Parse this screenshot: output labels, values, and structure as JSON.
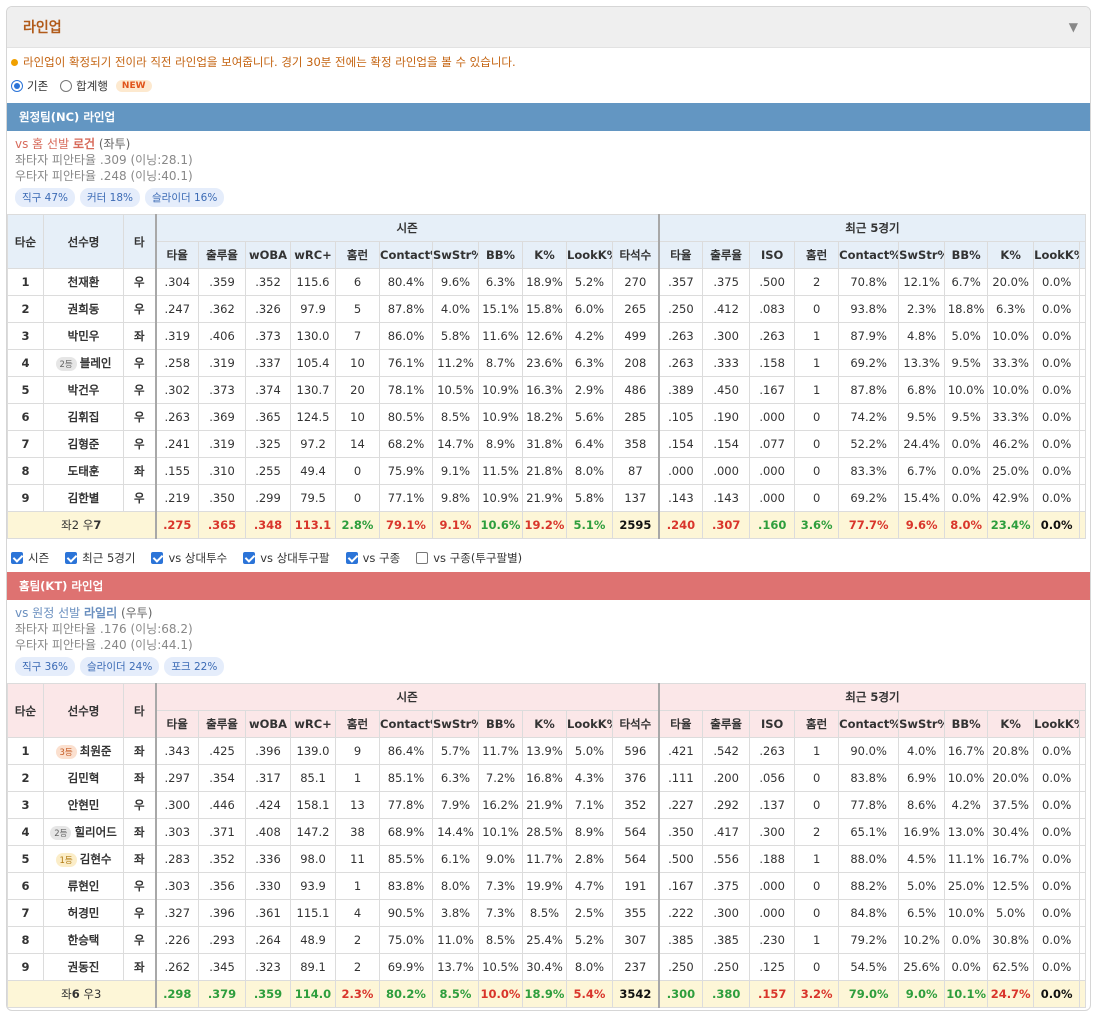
{
  "panel": {
    "title": "라인업",
    "notice": "라인업이 확정되기 전이라 직전 라인업을 보여줍니다. 경기 30분 전에는 확정 라인업을 볼 수 있습니다.",
    "radio_basic": "기존",
    "radio_sum": "합계행",
    "new_badge": "NEW",
    "selected": "기존"
  },
  "headers": {
    "order": "타순",
    "player": "선수명",
    "bat": "타",
    "season": "시즌",
    "recent": "최근 5경기",
    "season_cols": [
      "타율",
      "출루율",
      "wOBA",
      "wRC+",
      "홈런",
      "Contact%",
      "SwStr%",
      "BB%",
      "K%",
      "LookK%",
      "타석수"
    ],
    "recent_cols": [
      "타율",
      "출루율",
      "ISO",
      "홈런",
      "Contact%",
      "SwStr%",
      "BB%",
      "K%",
      "LookK%"
    ]
  },
  "away": {
    "bar": "원정팀(NC) 라인업",
    "vs_prefix": "vs 홈 선발",
    "pitcher": "로건",
    "hand": "(좌투)",
    "lhb": "좌타자 피안타율 .309 (이닝:28.1)",
    "rhb": "우타자 피안타율 .248 (이닝:40.1)",
    "pitches": [
      "직구 47%",
      "커터 18%",
      "슬라이더 16%"
    ],
    "rows": [
      {
        "n": "1",
        "name": "천재환",
        "badge": "",
        "b": "우",
        "s": [
          ".304",
          ".359",
          ".352",
          "115.6",
          "6",
          "80.4%",
          "9.6%",
          "6.3%",
          "18.9%",
          "5.2%",
          "270"
        ],
        "r": [
          ".357",
          ".375",
          ".500",
          "2",
          "70.8%",
          "12.1%",
          "6.7%",
          "20.0%",
          "0.0%"
        ]
      },
      {
        "n": "2",
        "name": "권희동",
        "badge": "",
        "b": "우",
        "s": [
          ".247",
          ".362",
          ".326",
          "97.9",
          "5",
          "87.8%",
          "4.0%",
          "15.1%",
          "15.8%",
          "6.0%",
          "265"
        ],
        "r": [
          ".250",
          ".412",
          ".083",
          "0",
          "93.8%",
          "2.3%",
          "18.8%",
          "6.3%",
          "0.0%"
        ]
      },
      {
        "n": "3",
        "name": "박민우",
        "badge": "",
        "b": "좌",
        "s": [
          ".319",
          ".406",
          ".373",
          "130.0",
          "7",
          "86.0%",
          "5.8%",
          "11.6%",
          "12.6%",
          "4.2%",
          "499"
        ],
        "r": [
          ".263",
          ".300",
          ".263",
          "1",
          "87.9%",
          "4.8%",
          "5.0%",
          "10.0%",
          "0.0%"
        ]
      },
      {
        "n": "4",
        "name": "블레인",
        "badge": "2등",
        "bc": "b2",
        "b": "우",
        "s": [
          ".258",
          ".319",
          ".337",
          "105.4",
          "10",
          "76.1%",
          "11.2%",
          "8.7%",
          "23.6%",
          "6.3%",
          "208"
        ],
        "r": [
          ".263",
          ".333",
          ".158",
          "1",
          "69.2%",
          "13.3%",
          "9.5%",
          "33.3%",
          "0.0%"
        ]
      },
      {
        "n": "5",
        "name": "박건우",
        "badge": "",
        "b": "우",
        "s": [
          ".302",
          ".373",
          ".374",
          "130.7",
          "20",
          "78.1%",
          "10.5%",
          "10.9%",
          "16.3%",
          "2.9%",
          "486"
        ],
        "r": [
          ".389",
          ".450",
          ".167",
          "1",
          "87.8%",
          "6.8%",
          "10.0%",
          "10.0%",
          "0.0%"
        ]
      },
      {
        "n": "6",
        "name": "김휘집",
        "badge": "",
        "b": "우",
        "s": [
          ".263",
          ".369",
          ".365",
          "124.5",
          "10",
          "80.5%",
          "8.5%",
          "10.9%",
          "18.2%",
          "5.6%",
          "285"
        ],
        "r": [
          ".105",
          ".190",
          ".000",
          "0",
          "74.2%",
          "9.5%",
          "9.5%",
          "33.3%",
          "0.0%"
        ]
      },
      {
        "n": "7",
        "name": "김형준",
        "badge": "",
        "b": "우",
        "s": [
          ".241",
          ".319",
          ".325",
          "97.2",
          "14",
          "68.2%",
          "14.7%",
          "8.9%",
          "31.8%",
          "6.4%",
          "358"
        ],
        "r": [
          ".154",
          ".154",
          ".077",
          "0",
          "52.2%",
          "24.4%",
          "0.0%",
          "46.2%",
          "0.0%"
        ]
      },
      {
        "n": "8",
        "name": "도태훈",
        "badge": "",
        "b": "좌",
        "s": [
          ".155",
          ".310",
          ".255",
          "49.4",
          "0",
          "75.9%",
          "9.1%",
          "11.5%",
          "21.8%",
          "8.0%",
          "87"
        ],
        "r": [
          ".000",
          ".000",
          ".000",
          "0",
          "83.3%",
          "6.7%",
          "0.0%",
          "25.0%",
          "0.0%"
        ]
      },
      {
        "n": "9",
        "name": "김한별",
        "badge": "",
        "b": "우",
        "s": [
          ".219",
          ".350",
          ".299",
          "79.5",
          "0",
          "77.1%",
          "9.8%",
          "10.9%",
          "21.9%",
          "5.8%",
          "137"
        ],
        "r": [
          ".143",
          ".143",
          ".000",
          "0",
          "69.2%",
          "15.4%",
          "0.0%",
          "42.9%",
          "0.0%"
        ]
      }
    ],
    "total": {
      "label_pre": "좌2 우",
      "label_bold": "7",
      "s": [
        ".275",
        ".365",
        ".348",
        "113.1",
        "2.8%",
        "79.1%",
        "9.1%",
        "10.6%",
        "19.2%",
        "5.1%",
        "2595"
      ],
      "sc": [
        "r",
        "r",
        "r",
        "r",
        "g",
        "r",
        "r",
        "g",
        "r",
        "g",
        "k"
      ],
      "r": [
        ".240",
        ".307",
        ".160",
        "3.6%",
        "77.7%",
        "9.6%",
        "8.0%",
        "23.4%",
        "0.0%"
      ],
      "rc": [
        "r",
        "r",
        "g",
        "g",
        "r",
        "r",
        "r",
        "g",
        "k"
      ]
    }
  },
  "checks": [
    {
      "label": "시즌",
      "on": true
    },
    {
      "label": "최근 5경기",
      "on": true
    },
    {
      "label": "vs 상대투수",
      "on": true
    },
    {
      "label": "vs 상대투구팔",
      "on": true
    },
    {
      "label": "vs 구종",
      "on": true
    },
    {
      "label": "vs 구종(투구팔별)",
      "on": false
    }
  ],
  "home": {
    "bar": "홈팀(KT) 라인업",
    "vs_prefix": "vs 원정 선발",
    "pitcher": "라일리",
    "hand": "(우투)",
    "lhb": "좌타자 피안타율 .176 (이닝:68.2)",
    "rhb": "우타자 피안타율 .240 (이닝:44.1)",
    "pitches": [
      "직구 36%",
      "슬라이더 24%",
      "포크 22%"
    ],
    "rows": [
      {
        "n": "1",
        "name": "최원준",
        "badge": "3등",
        "bc": "b3",
        "b": "좌",
        "s": [
          ".343",
          ".425",
          ".396",
          "139.0",
          "9",
          "86.4%",
          "5.7%",
          "11.7%",
          "13.9%",
          "5.0%",
          "596"
        ],
        "r": [
          ".421",
          ".542",
          ".263",
          "1",
          "90.0%",
          "4.0%",
          "16.7%",
          "20.8%",
          "0.0%"
        ]
      },
      {
        "n": "2",
        "name": "김민혁",
        "badge": "",
        "b": "좌",
        "s": [
          ".297",
          ".354",
          ".317",
          "85.1",
          "1",
          "85.1%",
          "6.3%",
          "7.2%",
          "16.8%",
          "4.3%",
          "376"
        ],
        "r": [
          ".111",
          ".200",
          ".056",
          "0",
          "83.8%",
          "6.9%",
          "10.0%",
          "20.0%",
          "0.0%"
        ]
      },
      {
        "n": "3",
        "name": "안현민",
        "badge": "",
        "b": "우",
        "s": [
          ".300",
          ".446",
          ".424",
          "158.1",
          "13",
          "77.8%",
          "7.9%",
          "16.2%",
          "21.9%",
          "7.1%",
          "352"
        ],
        "r": [
          ".227",
          ".292",
          ".137",
          "0",
          "77.8%",
          "8.6%",
          "4.2%",
          "37.5%",
          "0.0%"
        ]
      },
      {
        "n": "4",
        "name": "힐리어드",
        "badge": "2등",
        "bc": "b2",
        "b": "좌",
        "s": [
          ".303",
          ".371",
          ".408",
          "147.2",
          "38",
          "68.9%",
          "14.4%",
          "10.1%",
          "28.5%",
          "8.9%",
          "564"
        ],
        "r": [
          ".350",
          ".417",
          ".300",
          "2",
          "65.1%",
          "16.9%",
          "13.0%",
          "30.4%",
          "0.0%"
        ]
      },
      {
        "n": "5",
        "name": "김현수",
        "badge": "1등",
        "bc": "b1",
        "b": "좌",
        "s": [
          ".283",
          ".352",
          ".336",
          "98.0",
          "11",
          "85.5%",
          "6.1%",
          "9.0%",
          "11.7%",
          "2.8%",
          "564"
        ],
        "r": [
          ".500",
          ".556",
          ".188",
          "1",
          "88.0%",
          "4.5%",
          "11.1%",
          "16.7%",
          "0.0%"
        ]
      },
      {
        "n": "6",
        "name": "류현인",
        "badge": "",
        "b": "우",
        "s": [
          ".303",
          ".356",
          ".330",
          "93.9",
          "1",
          "83.8%",
          "8.0%",
          "7.3%",
          "19.9%",
          "4.7%",
          "191"
        ],
        "r": [
          ".167",
          ".375",
          ".000",
          "0",
          "88.2%",
          "5.0%",
          "25.0%",
          "12.5%",
          "0.0%"
        ]
      },
      {
        "n": "7",
        "name": "허경민",
        "badge": "",
        "b": "우",
        "s": [
          ".327",
          ".396",
          ".361",
          "115.1",
          "4",
          "90.5%",
          "3.8%",
          "7.3%",
          "8.5%",
          "2.5%",
          "355"
        ],
        "r": [
          ".222",
          ".300",
          ".000",
          "0",
          "84.8%",
          "6.5%",
          "10.0%",
          "5.0%",
          "0.0%"
        ]
      },
      {
        "n": "8",
        "name": "한승택",
        "badge": "",
        "b": "우",
        "s": [
          ".226",
          ".293",
          ".264",
          "48.9",
          "2",
          "75.0%",
          "11.0%",
          "8.5%",
          "25.4%",
          "5.2%",
          "307"
        ],
        "r": [
          ".385",
          ".385",
          ".230",
          "1",
          "79.2%",
          "10.2%",
          "0.0%",
          "30.8%",
          "0.0%"
        ]
      },
      {
        "n": "9",
        "name": "권동진",
        "badge": "",
        "b": "좌",
        "s": [
          ".262",
          ".345",
          ".323",
          "89.1",
          "2",
          "69.9%",
          "13.7%",
          "10.5%",
          "30.4%",
          "8.0%",
          "237"
        ],
        "r": [
          ".250",
          ".250",
          ".125",
          "0",
          "54.5%",
          "25.6%",
          "0.0%",
          "62.5%",
          "0.0%"
        ]
      }
    ],
    "total": {
      "label_pre": "좌",
      "label_bold": "6",
      "label_post": " 우3",
      "s": [
        ".298",
        ".379",
        ".359",
        "114.0",
        "2.3%",
        "80.2%",
        "8.5%",
        "10.0%",
        "18.9%",
        "5.4%",
        "3542"
      ],
      "sc": [
        "g",
        "g",
        "g",
        "g",
        "r",
        "g",
        "g",
        "r",
        "g",
        "r",
        "k"
      ],
      "r": [
        ".300",
        ".380",
        ".157",
        "3.2%",
        "79.0%",
        "9.0%",
        "10.1%",
        "24.7%",
        "0.0%"
      ],
      "rc": [
        "g",
        "g",
        "r",
        "r",
        "g",
        "g",
        "g",
        "r",
        "k"
      ]
    }
  }
}
